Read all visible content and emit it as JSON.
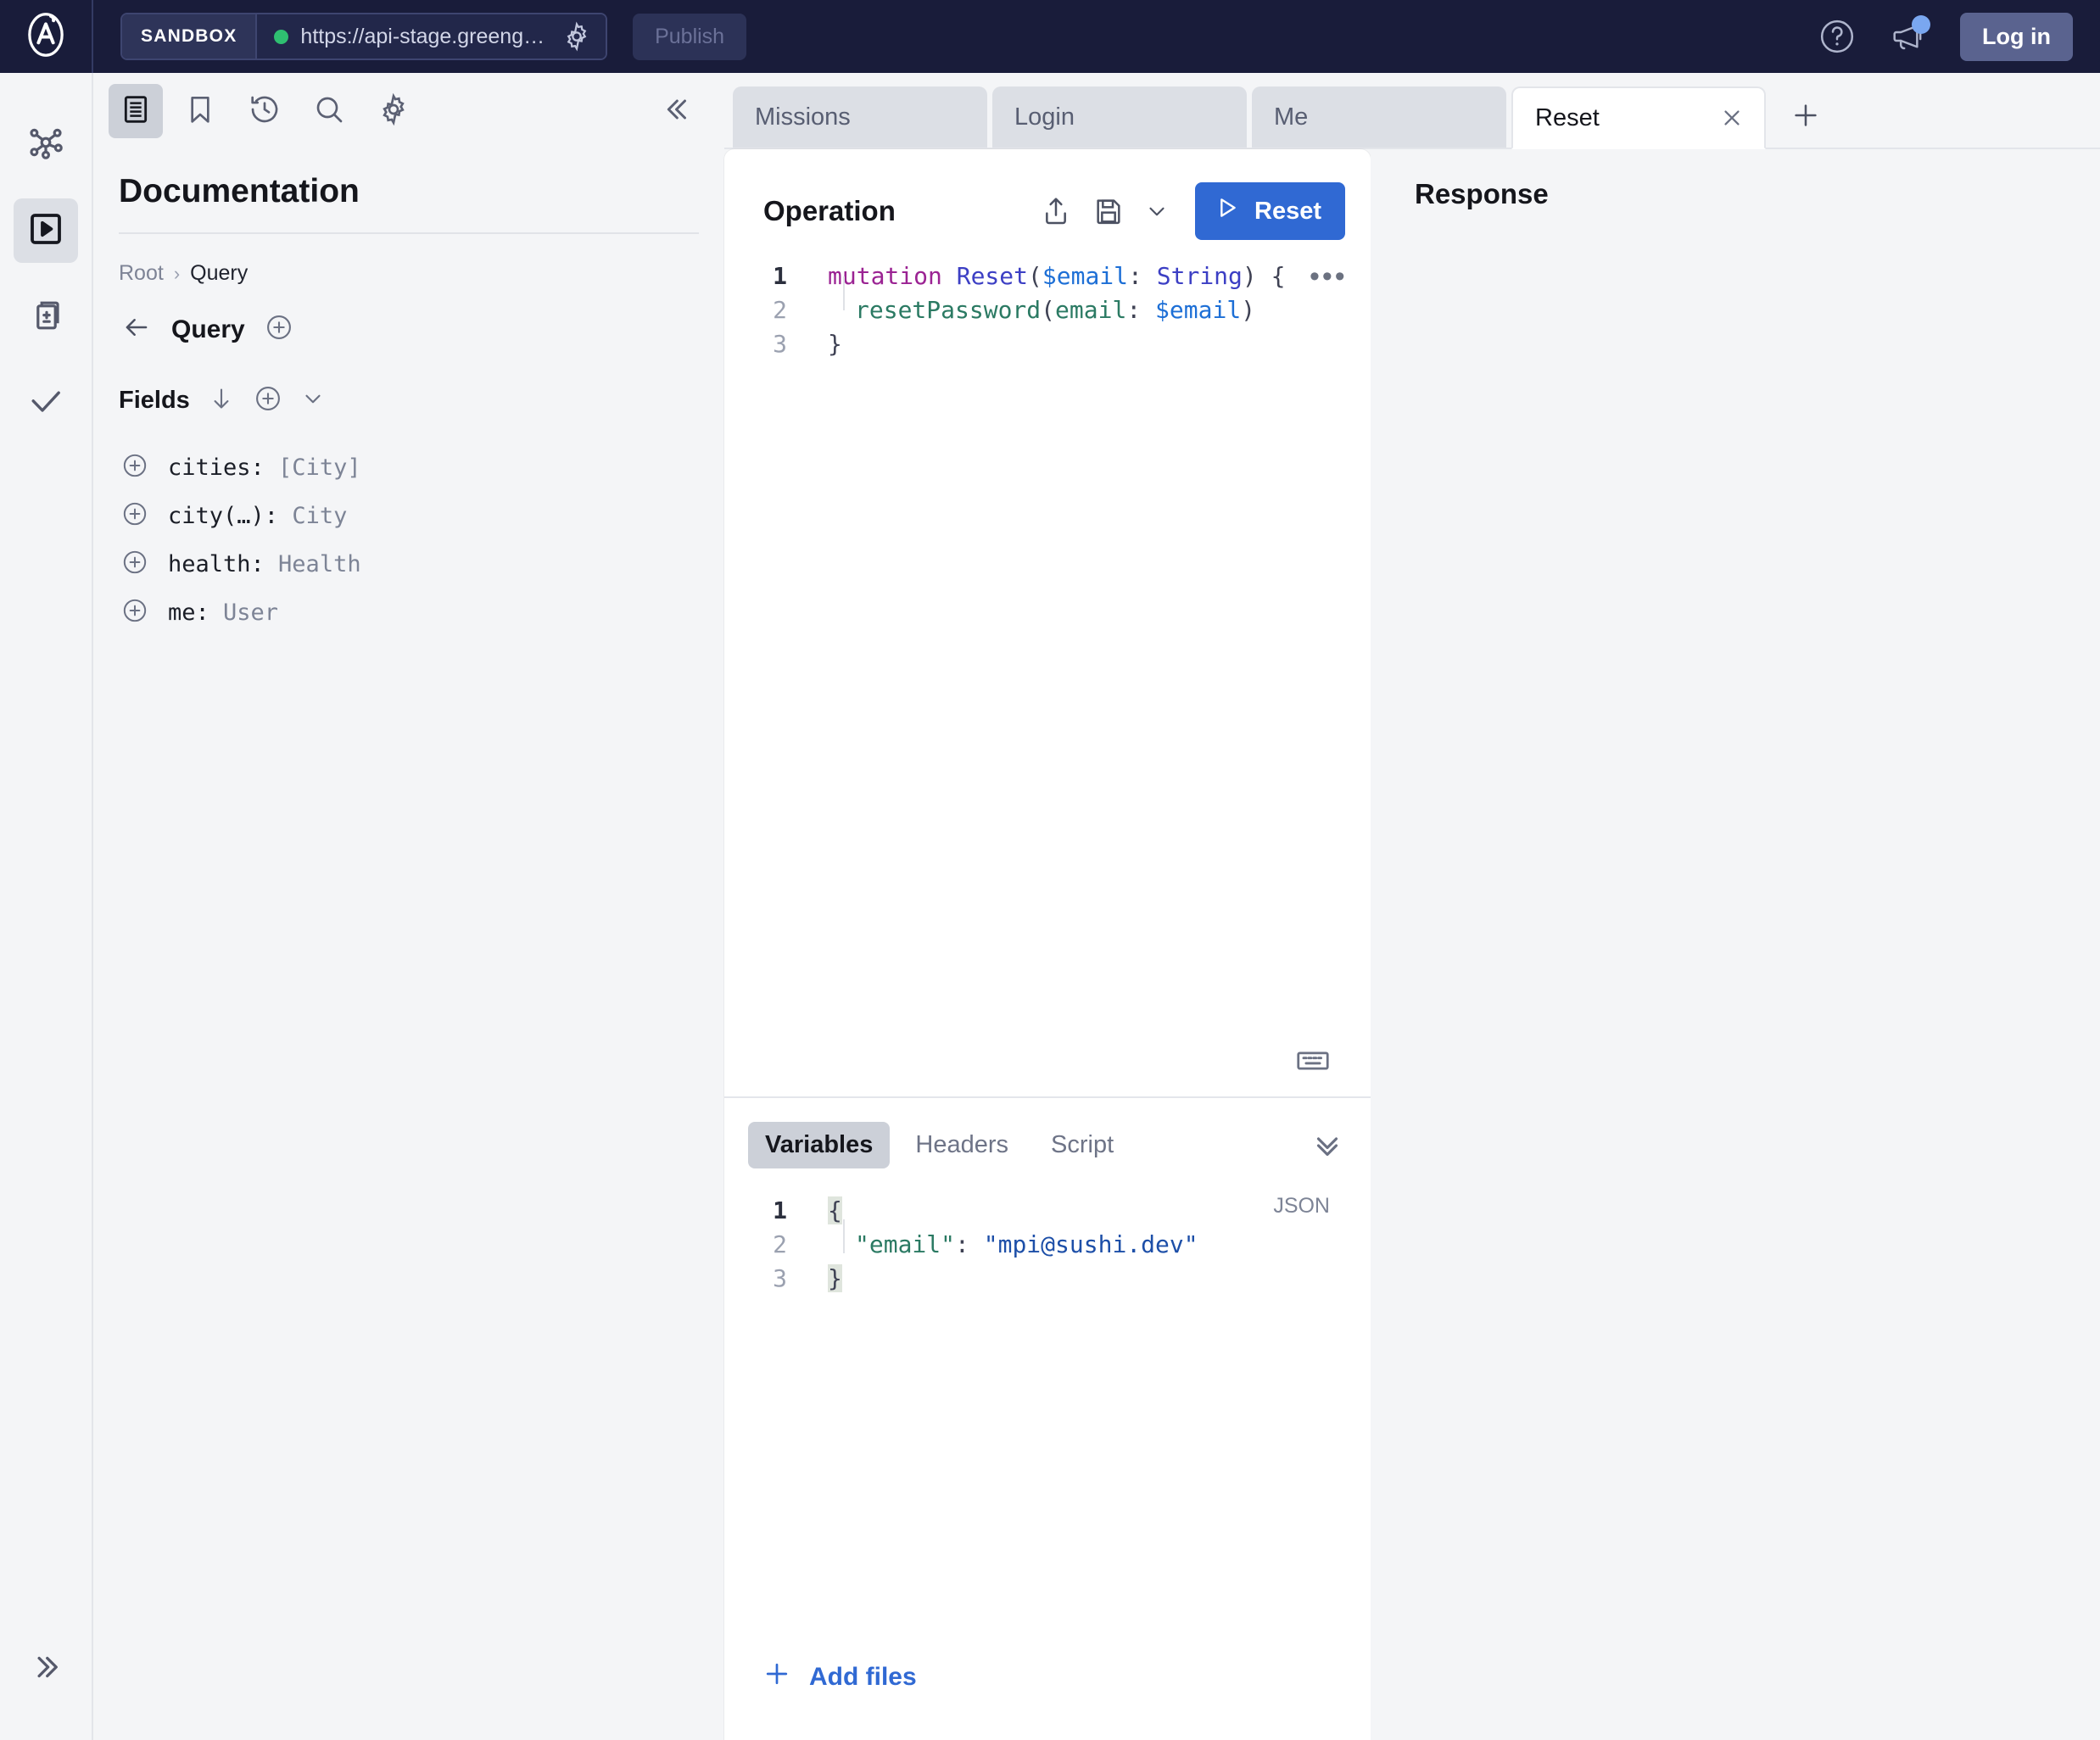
{
  "topbar": {
    "logo_icon": "apollo-logo-icon",
    "sandbox_label": "SANDBOX",
    "endpoint_url": "https://api-stage.greeng…",
    "endpoint_status": "connected",
    "settings_icon": "gear-icon",
    "publish_label": "Publish",
    "help_icon": "help-circle-icon",
    "announcements_icon": "megaphone-icon",
    "login_label": "Log in",
    "colors": {
      "bar_bg": "#191c3a",
      "status_dot": "#2fbf71",
      "login_bg": "#5a638f",
      "notification_dot": "#7aa7f0"
    }
  },
  "rail": {
    "items": [
      {
        "name": "graph-icon",
        "active": false
      },
      {
        "name": "explorer-icon",
        "active": true
      },
      {
        "name": "schema-diff-icon",
        "active": false
      },
      {
        "name": "checks-icon",
        "active": false
      }
    ],
    "expand_icon": "chevron-double-right-icon"
  },
  "doc_panel": {
    "toolbar": [
      {
        "name": "documentation-icon",
        "active": true
      },
      {
        "name": "bookmark-icon",
        "active": false
      },
      {
        "name": "history-icon",
        "active": false
      },
      {
        "name": "search-icon",
        "active": false
      },
      {
        "name": "settings-icon",
        "active": false
      }
    ],
    "collapse_icon": "chevron-double-left-icon",
    "title": "Documentation",
    "breadcrumb": {
      "root": "Root",
      "separator": "›",
      "current": "Query"
    },
    "nav": {
      "back_icon": "arrow-left-icon",
      "title": "Query",
      "add_icon": "plus-circle-icon"
    },
    "fields_section": {
      "label": "Fields",
      "sort_icon": "arrow-down-icon",
      "add_icon": "plus-circle-icon",
      "chevron_icon": "chevron-down-icon"
    },
    "fields": [
      {
        "name": "cities",
        "signature": "cities: ",
        "type": "[City]"
      },
      {
        "name": "city",
        "signature": "city(…): ",
        "type": "City"
      },
      {
        "name": "health",
        "signature": "health: ",
        "type": "Health"
      },
      {
        "name": "me",
        "signature": "me: ",
        "type": "User"
      }
    ]
  },
  "tabs": {
    "items": [
      {
        "label": "Missions",
        "active": false
      },
      {
        "label": "Login",
        "active": false
      },
      {
        "label": "Me",
        "active": false
      },
      {
        "label": "Reset",
        "active": true,
        "close_icon": "close-icon"
      }
    ],
    "new_tab_icon": "plus-icon"
  },
  "operation": {
    "title": "Operation",
    "share_icon": "share-upload-icon",
    "save_icon": "save-floppy-icon",
    "save_dropdown_icon": "chevron-down-icon",
    "run_label": "Reset",
    "run_icon": "play-triangle-icon",
    "more_icon": "ellipsis-icon",
    "keyboard_icon": "keyboard-icon",
    "code": {
      "lines": [
        {
          "number": "1",
          "current": true
        },
        {
          "number": "2",
          "current": false
        },
        {
          "number": "3",
          "current": false
        }
      ],
      "line1": {
        "keyword": "mutation",
        "space": " ",
        "op_name": "Reset",
        "open_paren": "(",
        "variable": "$email",
        "colon": ": ",
        "type": "String",
        "close_paren": ")",
        "brace": " {"
      },
      "line2": {
        "field": "resetPassword",
        "open_paren": "(",
        "arg": "email",
        "colon": ": ",
        "variable": "$email",
        "close_paren": ")"
      },
      "line3": {
        "brace": "}"
      }
    }
  },
  "variables_panel": {
    "tabs": [
      {
        "label": "Variables",
        "active": true
      },
      {
        "label": "Headers",
        "active": false
      },
      {
        "label": "Script",
        "active": false
      }
    ],
    "collapse_icon": "chevron-double-down-icon",
    "format_label": "JSON",
    "json": {
      "lines": [
        {
          "number": "1",
          "current": true
        },
        {
          "number": "2",
          "current": false
        },
        {
          "number": "3",
          "current": false
        }
      ],
      "line1": "{",
      "line2": {
        "key": "\"email\"",
        "colon": ": ",
        "value": "\"mpi@sushi.dev\""
      },
      "line3": "}"
    },
    "add_files": {
      "label": "Add files",
      "icon": "plus-icon"
    }
  },
  "response": {
    "title": "Response"
  }
}
